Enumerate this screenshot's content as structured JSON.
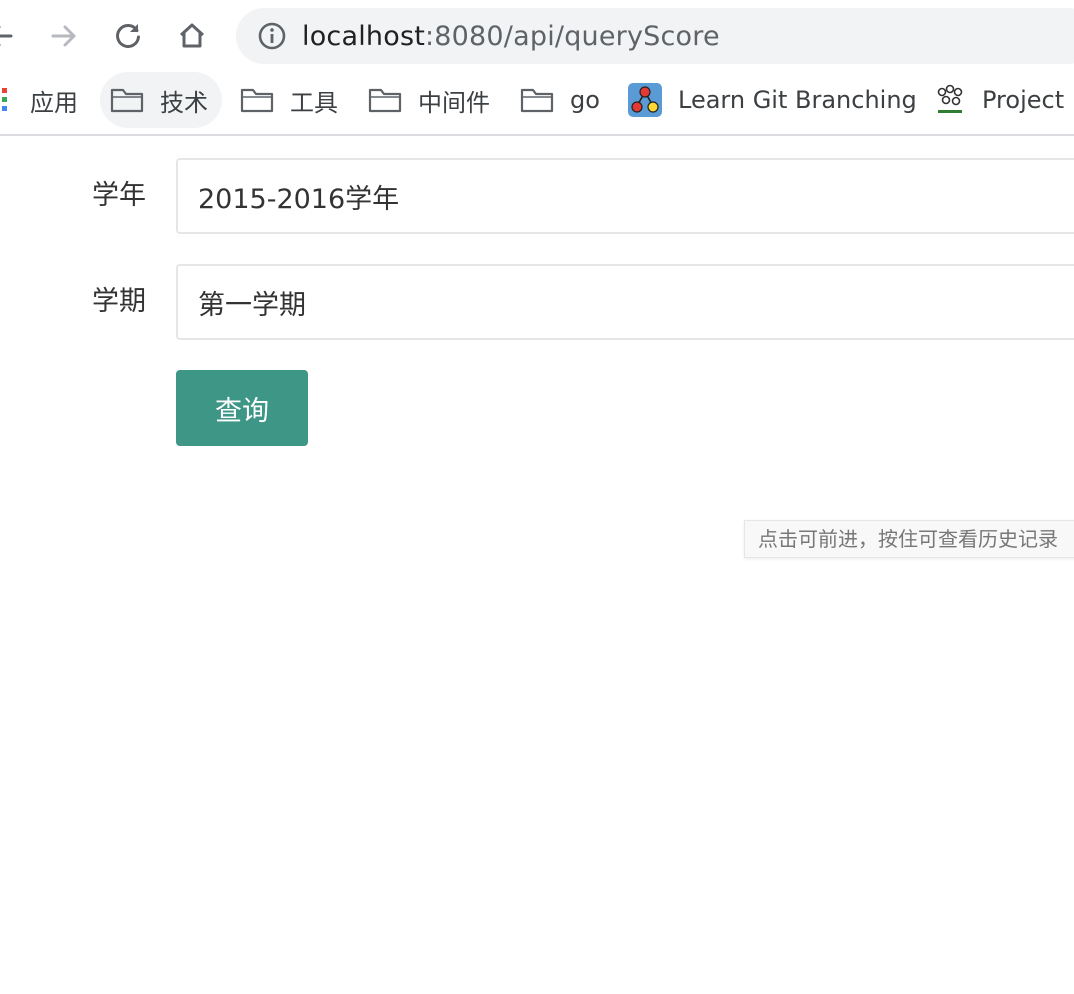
{
  "browser": {
    "url_host": "localhost",
    "url_rest": ":8080/api/queryScore"
  },
  "bookmarks": [
    {
      "label": "应用",
      "icon": "apps-grid-icon"
    },
    {
      "label": "技术",
      "icon": "folder-icon"
    },
    {
      "label": "工具",
      "icon": "folder-icon"
    },
    {
      "label": "中间件",
      "icon": "folder-icon"
    },
    {
      "label": "go",
      "icon": "folder-icon"
    },
    {
      "label": "Learn Git Branching",
      "icon": "git-branching-icon"
    },
    {
      "label": "Project",
      "icon": "dromara-icon"
    }
  ],
  "form": {
    "year_label": "学年",
    "year_value": "2015-2016学年",
    "term_label": "学期",
    "term_value": "第一学期",
    "query_label": "查询"
  },
  "tooltip": {
    "text": "点击可前进，按住可查看历史记录"
  },
  "colors": {
    "button": "#3d9686",
    "omnibox": "#f1f3f4"
  }
}
